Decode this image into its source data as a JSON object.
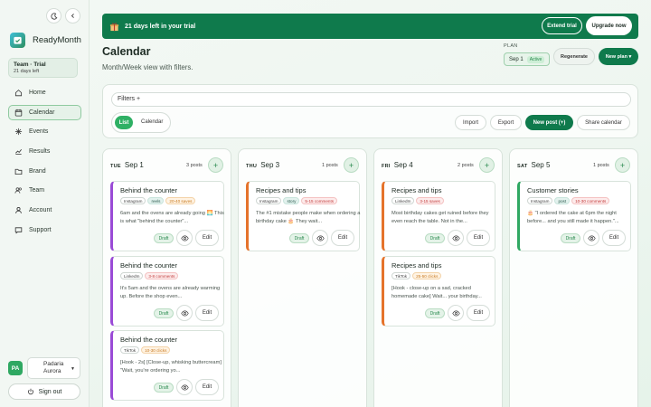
{
  "sidebar": {
    "brand": "ReadyMonth",
    "team_name": "Team · Trial",
    "team_days": "21 days left",
    "items": [
      {
        "label": "Home",
        "icon": "home-icon"
      },
      {
        "label": "Calendar",
        "icon": "calendar-icon",
        "active": true
      },
      {
        "label": "Events",
        "icon": "sparkle-icon"
      },
      {
        "label": "Results",
        "icon": "chart-icon"
      },
      {
        "label": "Brand",
        "icon": "folder-icon"
      },
      {
        "label": "Team",
        "icon": "users-icon"
      },
      {
        "label": "Account",
        "icon": "user-icon"
      },
      {
        "label": "Support",
        "icon": "chat-icon"
      }
    ],
    "avatar": "PA",
    "user_line1": "Padaria",
    "user_line2": "Aurora",
    "signout": "Sign out"
  },
  "banner": {
    "text": "21 days left in your trial",
    "extend": "Extend trial",
    "upgrade": "Upgrade now"
  },
  "header": {
    "title": "Calendar",
    "subtitle": "Month/Week view with filters.",
    "plan_label": "PLAN",
    "plan_value": "Sep 1",
    "plan_status": "Active",
    "regenerate": "Regenerate",
    "new_plan": "New plan ▾"
  },
  "toolbar": {
    "filters": "Filters  +",
    "list": "List",
    "calendar": "Calendar",
    "import": "Import",
    "export": "Export",
    "new_post": "New post (+)",
    "share": "Share calendar"
  },
  "columns": [
    {
      "dow": "TUE",
      "date": "Sep 1",
      "count": "3 posts",
      "posts": [
        {
          "title": "Behind the counter",
          "platform": "Instagram",
          "type": "reels",
          "eng": "20-40 saves",
          "eng_color": "orange",
          "accent": "purple",
          "body": "6am and the ovens are already going 🌅 This is what \"behind the counter\"...",
          "status": "Draft",
          "edit": "Edit"
        },
        {
          "title": "Behind the counter",
          "platform": "LinkedIn",
          "type": "",
          "eng": "3-8 comments",
          "eng_color": "red",
          "accent": "purple",
          "body": "It's 5am and the ovens are already warming up. Before the shop even...",
          "status": "Draft",
          "edit": "Edit"
        },
        {
          "title": "Behind the counter",
          "platform": "TikTok",
          "type": "",
          "eng": "10-30 clicks",
          "eng_color": "orange",
          "accent": "purple",
          "body": "[Hook - 2s] [Close-up, whisking buttercream] \"Wait, you're ordering yo...",
          "status": "Draft",
          "edit": "Edit"
        }
      ]
    },
    {
      "dow": "THU",
      "date": "Sep 3",
      "count": "1 posts",
      "posts": [
        {
          "title": "Recipes and tips",
          "platform": "Instagram",
          "type": "story",
          "eng": "5-15 comments",
          "eng_color": "red",
          "accent": "orange",
          "body": "The #1 mistake people make when ordering a birthday cake 🎂 They wait...",
          "status": "Draft",
          "edit": "Edit"
        }
      ]
    },
    {
      "dow": "FRI",
      "date": "Sep 4",
      "count": "2 posts",
      "posts": [
        {
          "title": "Recipes and tips",
          "platform": "LinkedIn",
          "type": "",
          "eng": "3-15 saves",
          "eng_color": "red",
          "accent": "orange",
          "body": "Most birthday cakes get ruined before they even reach the table. Not in the...",
          "status": "Draft",
          "edit": "Edit"
        },
        {
          "title": "Recipes and tips",
          "platform": "TikTok",
          "type": "",
          "eng": "25-50 clicks",
          "eng_color": "orange",
          "accent": "orange",
          "body": "[Hook - close-up on a sad, cracked homemade cake] Wait... your birthday...",
          "status": "Draft",
          "edit": "Edit"
        }
      ]
    },
    {
      "dow": "SAT",
      "date": "Sep 5",
      "count": "1 posts",
      "posts": [
        {
          "title": "Customer stories",
          "platform": "Instagram",
          "type": "post",
          "eng": "10-30 comments",
          "eng_color": "red",
          "accent": "green",
          "body": "🎂 \"I ordered the cake at 6pm the night before... and you still made it happen.\"...",
          "status": "Draft",
          "edit": "Edit"
        }
      ]
    }
  ]
}
